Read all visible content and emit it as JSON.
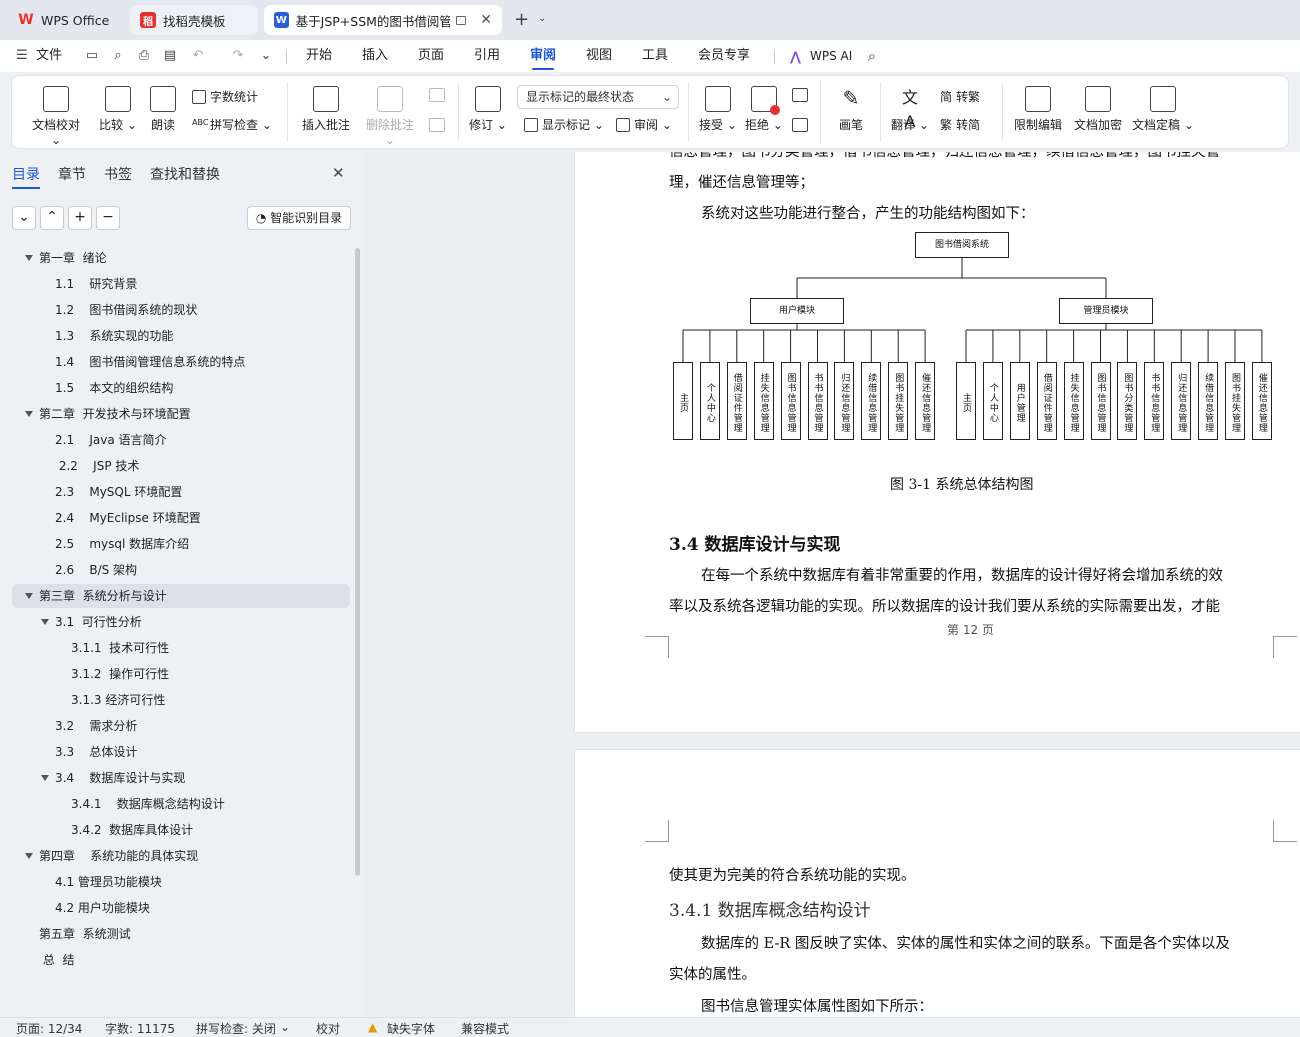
{
  "tabs": [
    {
      "label": "WPS Office",
      "icon": "wps-logo-icon"
    },
    {
      "label": "找稻壳模板",
      "icon": "docer-icon"
    },
    {
      "label": "基于JSP+SSM的图书借阅管理",
      "icon": "word-doc-icon"
    }
  ],
  "menu": {
    "file": "文件",
    "items": [
      "开始",
      "插入",
      "页面",
      "引用",
      "审阅",
      "视图",
      "工具",
      "会员专享"
    ],
    "active": "审阅",
    "wps_ai": "WPS AI"
  },
  "ribbon": {
    "doc_check": "文档校对",
    "compare": "比较",
    "read_aloud": "朗读",
    "word_count": "字数统计",
    "spell_check": "拼写检查",
    "insert_comment": "插入批注",
    "delete_comment": "删除批注",
    "revise": "修订",
    "show_markup_combo": "显示标记的最终状态",
    "show_markup": "显示标记",
    "review": "审阅",
    "accept": "接受",
    "reject": "拒绝",
    "pen": "画笔",
    "translate": "翻译",
    "to_traditional": "转繁",
    "to_simplified": "转简",
    "restrict_edit": "限制编辑",
    "encrypt": "文档加密",
    "finalize": "文档定稿"
  },
  "sidebar": {
    "tabs": [
      "目录",
      "章节",
      "书签",
      "查找和替换"
    ],
    "smart_btn": "智能识别目录",
    "toc": [
      {
        "text": "第一章  绪论",
        "level": 1,
        "expanded": true
      },
      {
        "text": "1.1    研究背景",
        "level": 2
      },
      {
        "text": "1.2    图书借阅系统的现状",
        "level": 2
      },
      {
        "text": "1.3    系统实现的功能",
        "level": 2
      },
      {
        "text": "1.4    图书借阅管理信息系统的特点",
        "level": 2
      },
      {
        "text": "1.5    本文的组织结构",
        "level": 2
      },
      {
        "text": "第二章  开发技术与环境配置",
        "level": 1,
        "expanded": true
      },
      {
        "text": "2.1    Java 语言简介",
        "level": 2
      },
      {
        "text": " 2.2    JSP 技术",
        "level": 2
      },
      {
        "text": "2.3    MySQL 环境配置",
        "level": 2
      },
      {
        "text": "2.4    MyEclipse 环境配置",
        "level": 2
      },
      {
        "text": "2.5    mysql 数据库介绍",
        "level": 2
      },
      {
        "text": "2.6    B/S 架构",
        "level": 2
      },
      {
        "text": "第三章  系统分析与设计",
        "level": 1,
        "expanded": true,
        "selected": true
      },
      {
        "text": "3.1  可行性分析",
        "level": 2,
        "expanded": true
      },
      {
        "text": "3.1.1  技术可行性",
        "level": 3
      },
      {
        "text": "3.1.2  操作可行性",
        "level": 3
      },
      {
        "text": "3.1.3 经济可行性",
        "level": 3
      },
      {
        "text": "3.2    需求分析",
        "level": 2
      },
      {
        "text": "3.3    总体设计",
        "level": 2
      },
      {
        "text": "3.4    数据库设计与实现",
        "level": 2,
        "expanded": true
      },
      {
        "text": "3.4.1    数据库概念结构设计",
        "level": 3
      },
      {
        "text": "3.4.2  数据库具体设计",
        "level": 3
      },
      {
        "text": "第四章    系统功能的具体实现",
        "level": 1,
        "expanded": true
      },
      {
        "text": "4.1 管理员功能模块",
        "level": 2
      },
      {
        "text": "4.2 用户功能模块",
        "level": 2
      },
      {
        "text": "第五章  系统测试",
        "level": 1
      },
      {
        "text": " 总  结",
        "level": 1
      }
    ]
  },
  "document": {
    "p1_line1": "信息管理，图书分类管理，借书信息管理，归还信息管理，续借信息管理，图书挂失管",
    "p1_line2": "理，催还信息管理等；",
    "p2": "系统对这些功能进行整合，产生的功能结构图如下：",
    "diagram": {
      "root": "图书借阅系统",
      "user_module": "用户模块",
      "admin_module": "管理员模块",
      "user_leaves": [
        "主页",
        "个人中心",
        "借阅证件管理",
        "挂失信息管理",
        "图书信息管理",
        "书书信息管理",
        "归还信息管理",
        "续借信息管理",
        "图书挂失管理",
        "催还信息管理"
      ],
      "admin_leaves": [
        "主页",
        "个人中心",
        "用户管理",
        "借阅证件管理",
        "挂失信息管理",
        "图书信息管理",
        "图书分类管理",
        "书书信息管理",
        "归还信息管理",
        "续借信息管理",
        "图书挂失管理",
        "催还信息管理"
      ]
    },
    "figure_caption": "图 3-1  系统总体结构图",
    "section_34": "3.4    数据库设计与实现",
    "p3_line1": "在每一个系统中数据库有着非常重要的作用，数据库的设计得好将会增加系统的效",
    "p3_line2": "率以及系统各逻辑功能的实现。所以数据库的设计我们要从系统的实际需要出发，才能",
    "page_footer": "第  12  页",
    "p4": "使其更为完美的符合系统功能的实现。",
    "section_341": "3.4.1    数据库概念结构设计",
    "p5_line1": "数据库的 E-R 图反映了实体、实体的属性和实体之间的联系。下面是各个实体以及",
    "p5_line2": "实体的属性。",
    "p6": "图书信息管理实体属性图如下所示："
  },
  "status": {
    "page": "页面: 12/34",
    "words": "字数: 11175",
    "spell": "拼写检查: 关闭",
    "proof": "校对",
    "missing_font": "缺失字体",
    "compat": "兼容模式"
  },
  "colors": {
    "accent": "#1d55d6",
    "wps_red": "#e8312f",
    "sidebar_bg": "#eef1f4"
  }
}
